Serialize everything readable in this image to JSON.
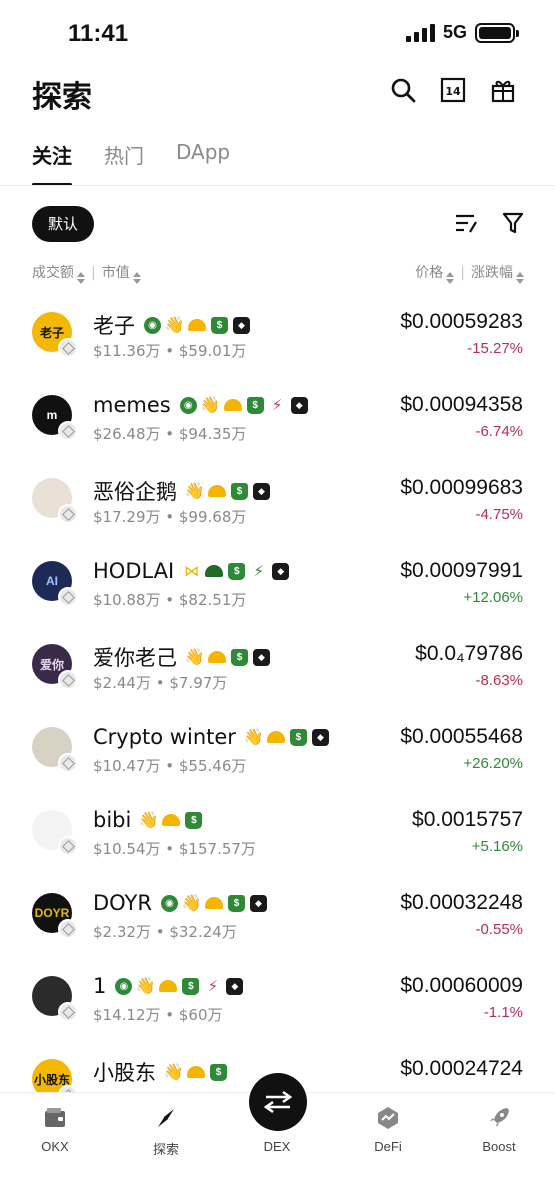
{
  "status": {
    "time": "11:41",
    "network": "5G"
  },
  "header": {
    "title": "探索"
  },
  "tabs": [
    {
      "label": "关注"
    },
    {
      "label": "热门"
    },
    {
      "label": "DApp"
    }
  ],
  "filters": {
    "default_label": "默认"
  },
  "columns": {
    "volume": "成交额",
    "market_cap": "市值",
    "price": "价格",
    "change": "涨跌幅"
  },
  "tokens": [
    {
      "name": "老子",
      "avatar_text": "老子",
      "avatar_bg": "#f5b800",
      "avatar_fg": "#111111",
      "volume": "$11.36万",
      "market_cap": "$59.01万",
      "price": "$0.00059283",
      "change": "-15.27%",
      "dir": "neg",
      "tags": [
        "verified",
        "hand",
        "hat",
        "bag",
        "owl"
      ]
    },
    {
      "name": "memes",
      "avatar_text": "m",
      "avatar_bg": "#111111",
      "avatar_fg": "#ffffff",
      "volume": "$26.48万",
      "market_cap": "$94.35万",
      "price": "$0.00094358",
      "change": "-6.74%",
      "dir": "neg",
      "tags": [
        "verified",
        "hand",
        "hat",
        "bag",
        "bolt",
        "owl"
      ]
    },
    {
      "name": "恶俗企鹅",
      "avatar_text": "",
      "avatar_bg": "#e9e1d6",
      "avatar_fg": "#111111",
      "volume": "$17.29万",
      "market_cap": "$99.68万",
      "price": "$0.00099683",
      "change": "-4.75%",
      "dir": "neg",
      "tags": [
        "hand",
        "hat",
        "bag",
        "owl"
      ]
    },
    {
      "name": "HODLAI",
      "avatar_text": "AI",
      "avatar_bg": "#1c2a55",
      "avatar_fg": "#9fc3ff",
      "volume": "$10.88万",
      "market_cap": "$82.51万",
      "price": "$0.00097991",
      "change": "+12.06%",
      "dir": "pos",
      "tags": [
        "bow",
        "hatdark",
        "bag",
        "boltgreen",
        "owl"
      ]
    },
    {
      "name": "爱你老己",
      "avatar_text": "爱你",
      "avatar_bg": "#3a2a4a",
      "avatar_fg": "#e8d8f0",
      "volume": "$2.44万",
      "market_cap": "$7.97万",
      "price": "$0.0₄79786",
      "change": "-8.63%",
      "dir": "neg",
      "tags": [
        "hand",
        "hat",
        "bag",
        "owl"
      ]
    },
    {
      "name": "Crypto winter",
      "avatar_text": "",
      "avatar_bg": "#d8d2c4",
      "avatar_fg": "#111111",
      "volume": "$10.47万",
      "market_cap": "$55.46万",
      "price": "$0.00055468",
      "change": "+26.20%",
      "dir": "pos",
      "tags": [
        "hand",
        "hat",
        "bag",
        "owl"
      ]
    },
    {
      "name": "bibi",
      "avatar_text": "",
      "avatar_bg": "#f3f3f3",
      "avatar_fg": "#111111",
      "volume": "$10.54万",
      "market_cap": "$157.57万",
      "price": "$0.0015757",
      "change": "+5.16%",
      "dir": "pos",
      "tags": [
        "hand",
        "hat",
        "bag"
      ]
    },
    {
      "name": "DOYR",
      "avatar_text": "DOYR",
      "avatar_bg": "#111111",
      "avatar_fg": "#e6b800",
      "volume": "$2.32万",
      "market_cap": "$32.24万",
      "price": "$0.00032248",
      "change": "-0.55%",
      "dir": "neg",
      "tags": [
        "verified",
        "hand",
        "hat",
        "bag",
        "owl"
      ]
    },
    {
      "name": "1",
      "avatar_text": "",
      "avatar_bg": "#2b2b2b",
      "avatar_fg": "#ffffff",
      "volume": "$14.12万",
      "market_cap": "$60万",
      "price": "$0.00060009",
      "change": "-1.1%",
      "dir": "neg",
      "tags": [
        "verified",
        "hand",
        "hat",
        "bag",
        "bolt",
        "owl"
      ]
    },
    {
      "name": "小股东",
      "avatar_text": "小股东",
      "avatar_bg": "#f5b800",
      "avatar_fg": "#111111",
      "volume": "",
      "market_cap": "",
      "price": "$0.00024724",
      "change": "",
      "dir": "pos",
      "tags": [
        "hand",
        "hat",
        "bag"
      ]
    }
  ],
  "nav": [
    {
      "label": "OKX",
      "icon": "wallet-icon"
    },
    {
      "label": "探索",
      "icon": "compass-icon"
    },
    {
      "label": "DEX",
      "icon": "swap-icon"
    },
    {
      "label": "DeFi",
      "icon": "defi-icon"
    },
    {
      "label": "Boost",
      "icon": "rocket-icon"
    }
  ]
}
